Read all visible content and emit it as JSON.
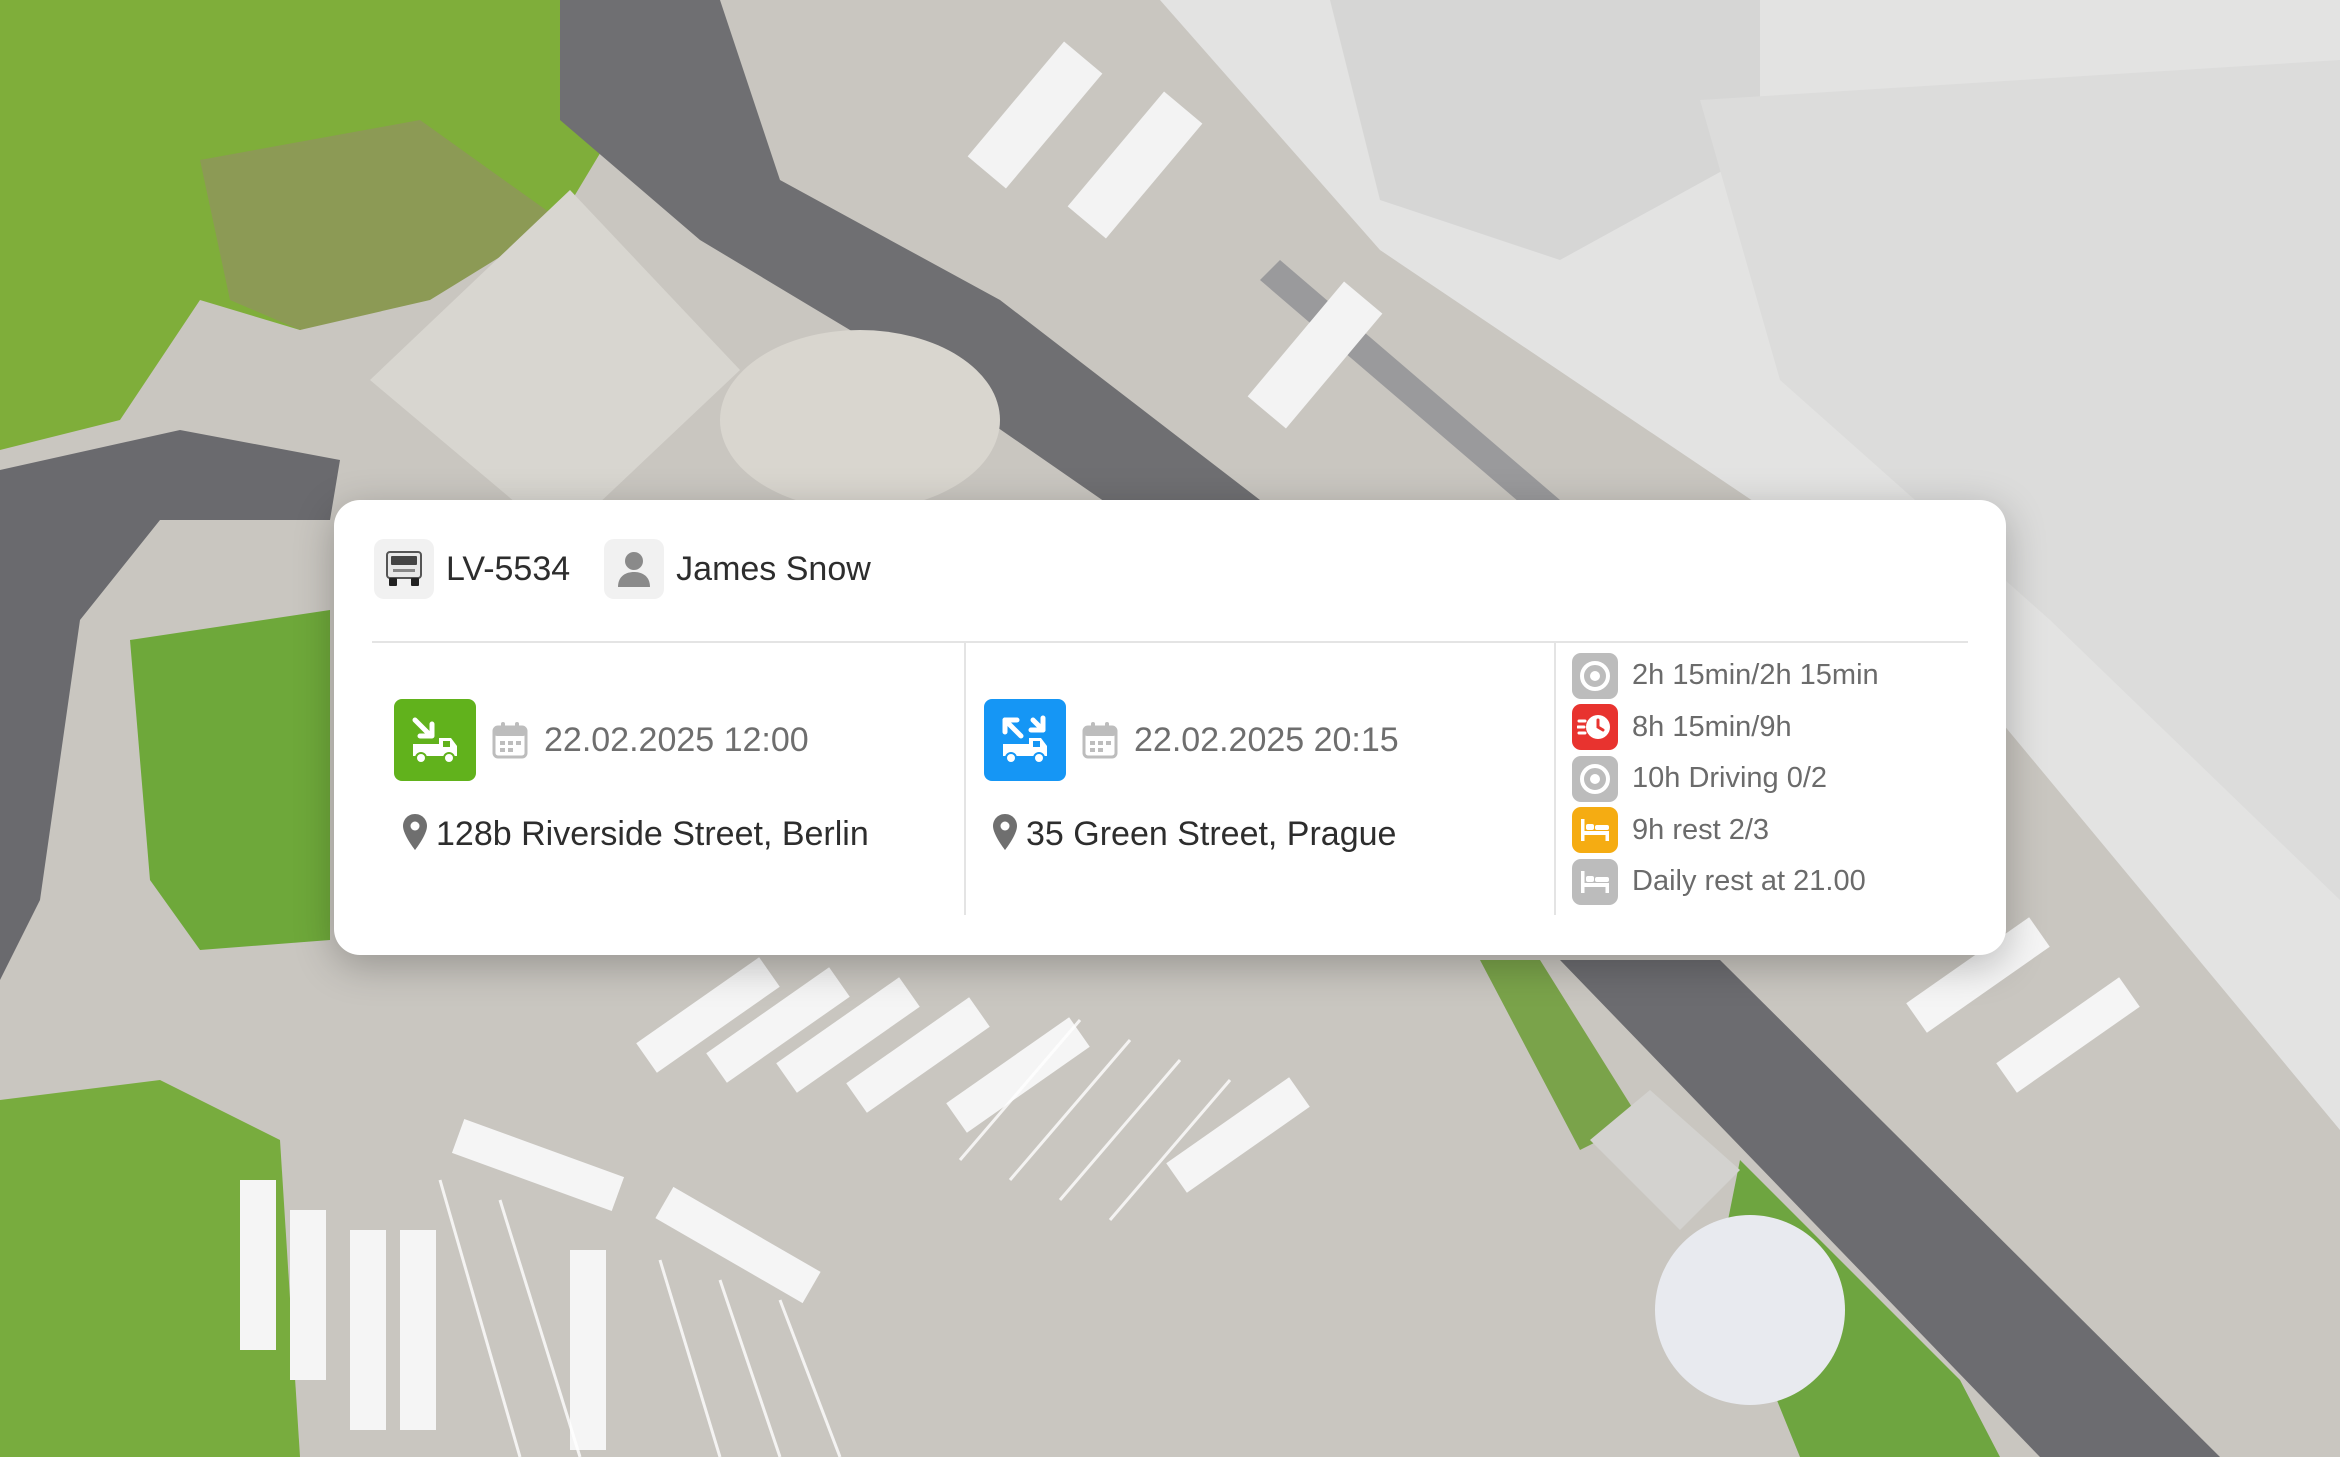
{
  "vehicle": {
    "plate": "LV-5534",
    "icon": "truck-icon"
  },
  "driver": {
    "name": "James Snow",
    "icon": "person-icon"
  },
  "pickup": {
    "icon": "unload-truck-icon",
    "color": "#61b21c",
    "datetime": "22.02.2025 12:00",
    "address": "128b Riverside Street, Berlin"
  },
  "delivery": {
    "icon": "load-truck-icon",
    "color": "#1596f5",
    "datetime": "22.02.2025 20:15",
    "address": "35 Green Street, Prague"
  },
  "stats": [
    {
      "icon": "steering-wheel-icon",
      "color": "#bcbcbc",
      "text": "2h 15min/2h 15min"
    },
    {
      "icon": "fast-clock-icon",
      "color": "#e8332f",
      "text": "8h 15min/9h"
    },
    {
      "icon": "steering-wheel-icon",
      "color": "#bcbcbc",
      "text": "10h Driving 0/2"
    },
    {
      "icon": "bed-icon",
      "color": "#f5ac12",
      "text": "9h rest 2/3"
    },
    {
      "icon": "bed-icon",
      "color": "#bcbcbc",
      "text": "Daily rest at 21.00"
    }
  ]
}
